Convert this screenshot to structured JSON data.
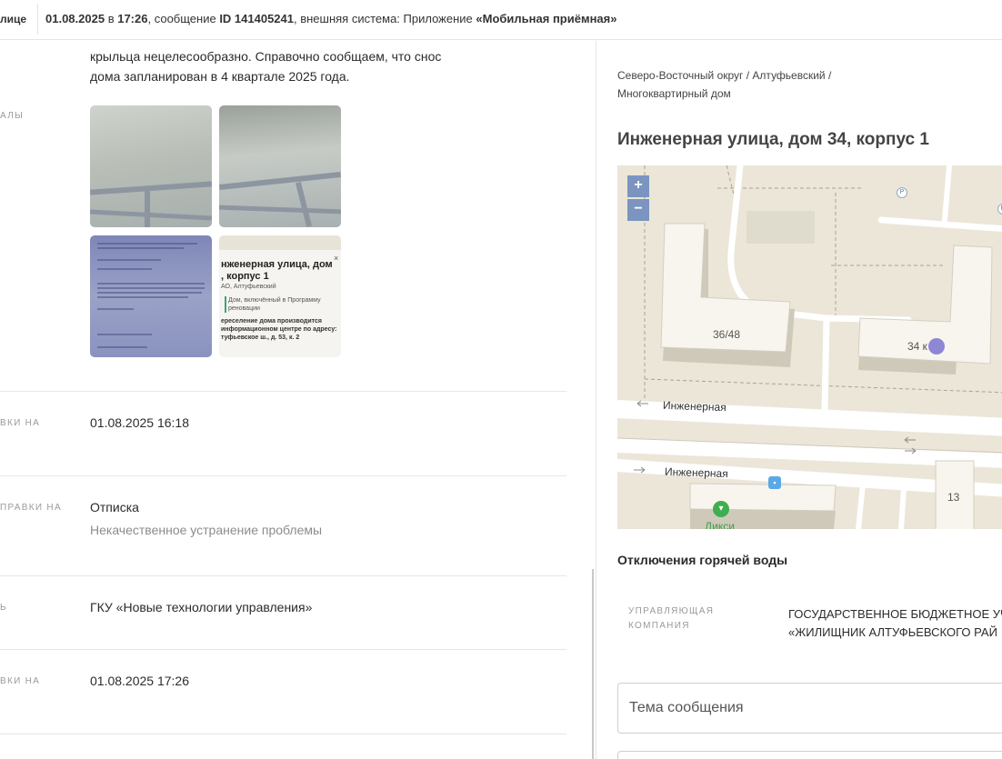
{
  "topbar": {
    "crumb": "лице",
    "date": "01.08.2025",
    "in_word": " в ",
    "time": "17:26",
    "msg_prefix": ", сообщение ",
    "msg_id": "ID 141405241",
    "system_prefix": ", внешняя система: Приложение ",
    "system_name": "«Мобильная приёмная»"
  },
  "left": {
    "answer_text": "крыльца нецелесообразно. Справочно сообщаем, что снос дома запланирован в 4 квартале 2025 года.",
    "materials_label": "АЛЫ",
    "thumb4": {
      "title": "нженерная улица, дом\n, корпус 1",
      "sub": "АО, Алтуфьевский",
      "badge": "Дом, включённый в Программу\nреновации",
      "info": "ереселение дома производится\nинформационном центре по адресу:\nтуфьевское ш., д. 53, к. 2",
      "close": "×"
    },
    "rows": [
      {
        "label": "ВКИ НА",
        "value": "01.08.2025 16:18",
        "sub": ""
      },
      {
        "label": "ПРАВКИ НА",
        "value": "Отписка",
        "sub": "Некачественное устранение проблемы"
      },
      {
        "label": "Ь",
        "value": "ГКУ «Новые технологии управления»",
        "sub": ""
      },
      {
        "label": "ВКИ НА",
        "value": "01.08.2025 17:26",
        "sub": ""
      }
    ]
  },
  "right": {
    "address_path": "Северо-Восточный округ / Алтуфьевский / Многоквартирный дом",
    "address_title": "Инженерная улица, дом 34, корпус 1",
    "map": {
      "zoom_in": "+",
      "zoom_out": "−",
      "street1": "Инженерная",
      "street2": "Инженерная",
      "house1": "36/48",
      "house2": "34 к",
      "house3": "13",
      "shop": "Дикси",
      "parking": "P"
    },
    "hot_water_title": "Отключения горячей воды",
    "management_label": "УПРАВЛЯЮЩАЯ КОМПАНИЯ",
    "management_value": "ГОСУДАРСТВЕННОЕ БЮДЖЕТНОЕ УЧ «ЖИЛИЩНИК АЛТУФЬЕВСКОГО РАЙ",
    "subject_placeholder": "Тема сообщения"
  }
}
